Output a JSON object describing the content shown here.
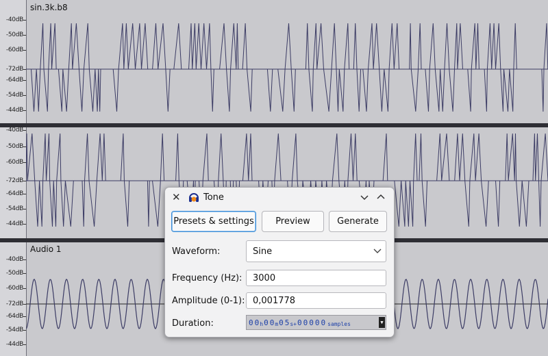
{
  "tracks": [
    {
      "name": "sin.3k.b8"
    },
    {
      "name": "Audio 1"
    }
  ],
  "ruler_ticks": [
    "-40dB",
    "-50dB",
    "-60dB",
    "-72dB",
    "-64dB",
    "-54dB",
    "-44dB"
  ],
  "dialog": {
    "title": "Tone",
    "presets_label": "Presets & settings",
    "preview_label": "Preview",
    "generate_label": "Generate",
    "waveform_label": "Waveform:",
    "waveform_value": "Sine",
    "frequency_label": "Frequency (Hz):",
    "frequency_value": "3000",
    "amplitude_label": "Amplitude (0-1):",
    "amplitude_value": "0,001778",
    "duration_label": "Duration:",
    "duration": {
      "h1": "0",
      "h2": "0",
      "h_unit": "h",
      "m1": "0",
      "m2": "0",
      "m_unit": "m",
      "s1": "0",
      "s2": "5",
      "s_unit": "s+",
      "samples": "00000",
      "samples_unit": "samples"
    }
  },
  "colors": {
    "track_bg": "#c9c9cd",
    "waveform": "#3b3b64",
    "duration_digits": "#1c3fa8",
    "focus_border": "#3d8ed8"
  },
  "icons": [
    "close-icon",
    "headphones-icon",
    "chevron-down-icon",
    "chevron-up-icon",
    "dropdown-caret-icon"
  ]
}
